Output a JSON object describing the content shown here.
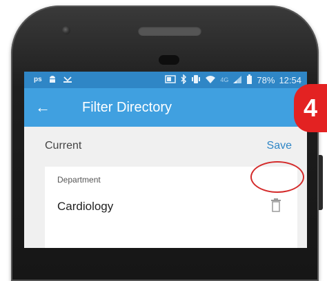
{
  "status_bar": {
    "left_icons": [
      "ps-icon",
      "android-icon",
      "missed-call-icon"
    ],
    "right_icons": [
      "cast-icon",
      "bluetooth-icon",
      "vibrate-icon",
      "wifi-icon",
      "lte-icon",
      "signal-icon",
      "battery-icon"
    ],
    "lte_text": "4G",
    "battery": "78%",
    "time": "12:54"
  },
  "app_bar": {
    "back_icon": "arrow-left-icon",
    "title": "Filter Directory"
  },
  "filter": {
    "section_label": "Current",
    "save_label": "Save",
    "card": {
      "field_label": "Department",
      "field_value": "Cardiology",
      "delete_icon": "trash-icon"
    }
  },
  "annotation": {
    "step_number": "4",
    "step_color": "#e32222",
    "highlight_color": "#d42a2a"
  },
  "colors": {
    "status_bar": "#2f86c6",
    "app_bar": "#40a0e0",
    "background": "#f0f0f0",
    "accent": "#2f86c6"
  }
}
